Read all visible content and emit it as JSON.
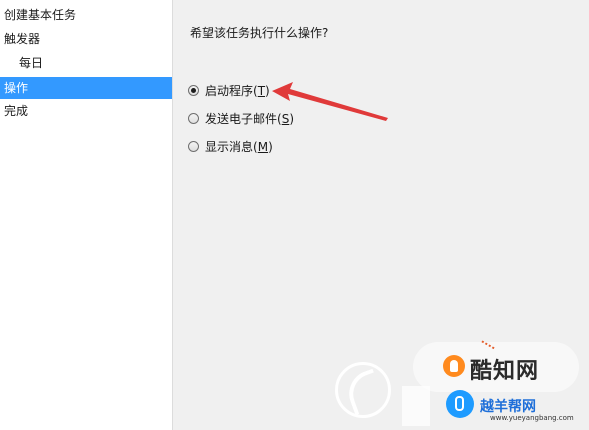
{
  "nav": {
    "items": [
      {
        "label": "创建基本任务",
        "selected": false,
        "indent": false
      },
      {
        "label": "触发器",
        "selected": false,
        "indent": false
      },
      {
        "label": "每日",
        "selected": false,
        "indent": true
      },
      {
        "label": "操作",
        "selected": true,
        "indent": false
      },
      {
        "label": "完成",
        "selected": false,
        "indent": false
      }
    ]
  },
  "main": {
    "question": "希望该任务执行什么操作?",
    "options": [
      {
        "label": "启动程序",
        "accelerator": "(T)",
        "accel_key": "T",
        "checked": true
      },
      {
        "label": "发送电子邮件",
        "accelerator": "(S)",
        "accel_key": "S",
        "checked": false
      },
      {
        "label": "显示消息",
        "accelerator": "(M)",
        "accel_key": "M",
        "checked": false
      }
    ]
  },
  "watermark": {
    "brand1": "酷知网",
    "brand2": "越羊帮网",
    "url": "www.yueyangbang.com"
  },
  "colors": {
    "selection": "#3399ff",
    "annotation_arrow": "#e03a3a",
    "window_bg": "#f0f0f0"
  },
  "icons": [
    "radio-button",
    "red-annotation-arrow",
    "watermark-logo"
  ]
}
